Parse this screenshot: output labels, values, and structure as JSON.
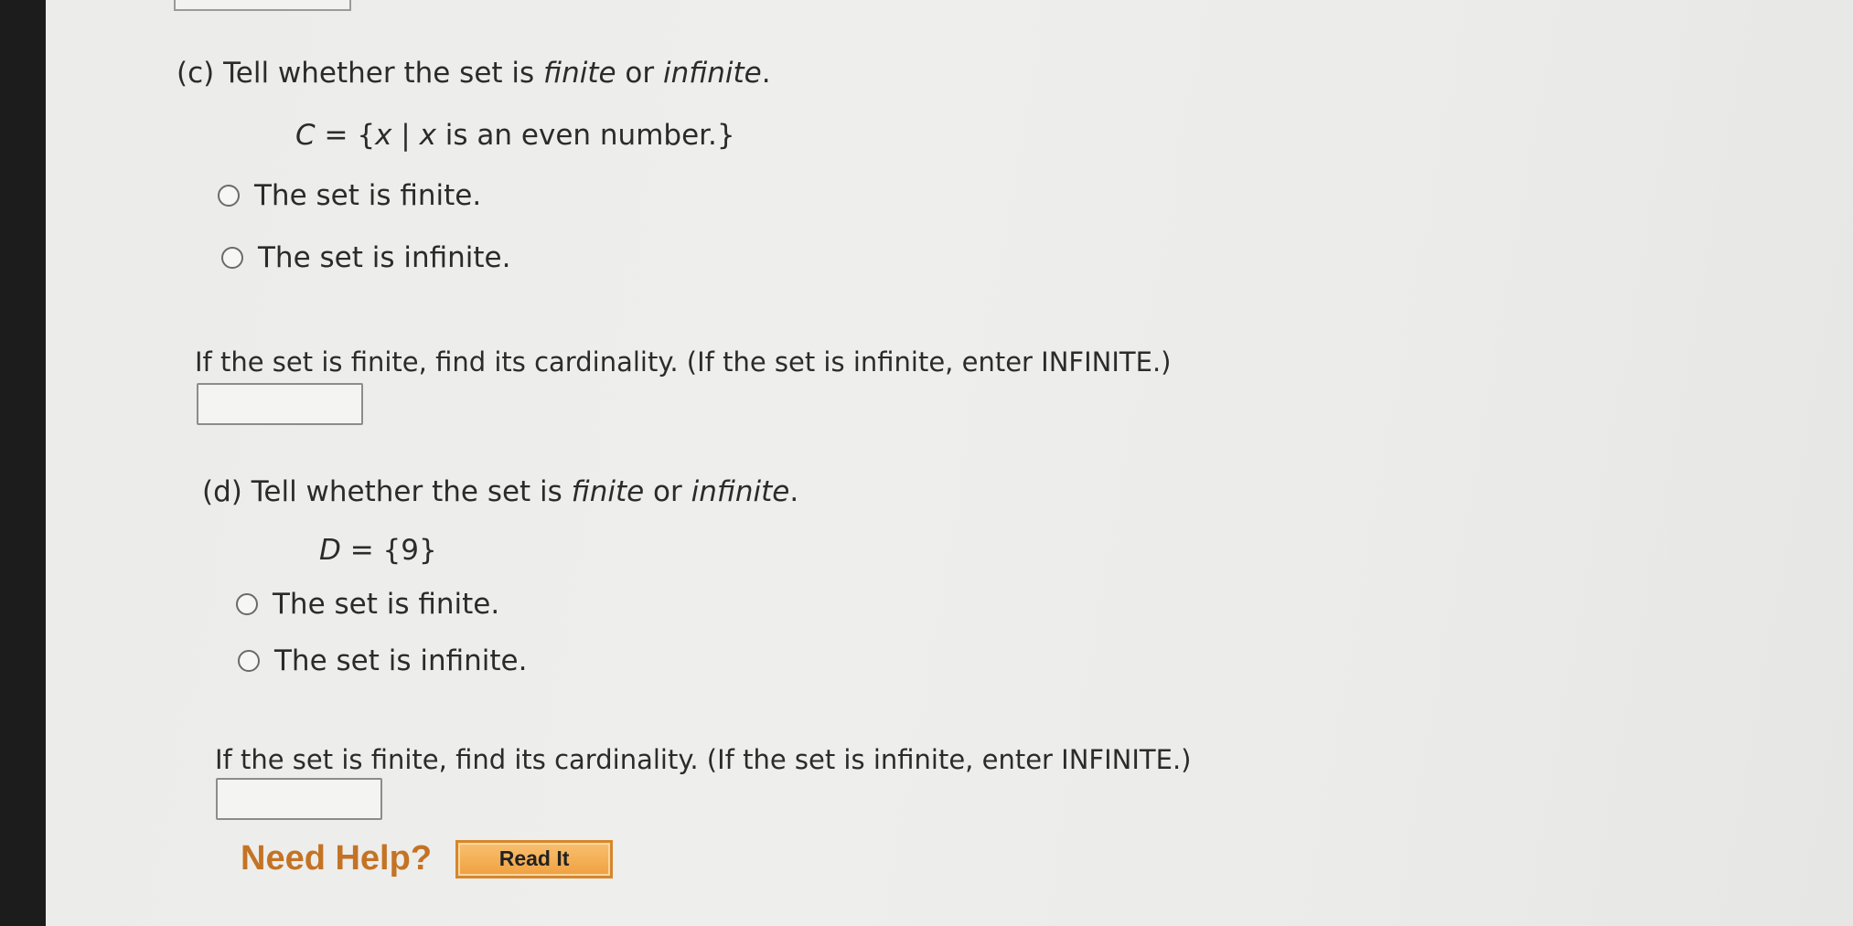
{
  "part_c": {
    "prompt_prefix": "(c) Tell whether the set is ",
    "prompt_finite": "finite",
    "prompt_or": " or ",
    "prompt_infinite": "infinite",
    "prompt_end": ".",
    "set_name": "C",
    "set_eq": " = {",
    "set_var1": "x",
    "set_bar": " | ",
    "set_var2": "x",
    "set_rest": " is an even number.}",
    "options": [
      "The set is finite.",
      "The set is infinite."
    ],
    "cardinality_instruction": "If the set is finite, find its cardinality. (If the set is infinite, enter INFINITE.)",
    "cardinality_value": ""
  },
  "part_d": {
    "prompt_prefix": "(d) Tell whether the set is ",
    "prompt_finite": "finite",
    "prompt_or": " or ",
    "prompt_infinite": "infinite",
    "prompt_end": ".",
    "set_name": "D",
    "set_rest": " = {9}",
    "options": [
      "The set is finite.",
      "The set is infinite."
    ],
    "cardinality_instruction": "If the set is finite, find its cardinality. (If the set is infinite, enter INFINITE.)",
    "cardinality_value": ""
  },
  "help": {
    "label": "Need Help?",
    "read_it": "Read It"
  },
  "colors": {
    "need_help": "#c47325",
    "read_it_button": "#f0a040"
  }
}
